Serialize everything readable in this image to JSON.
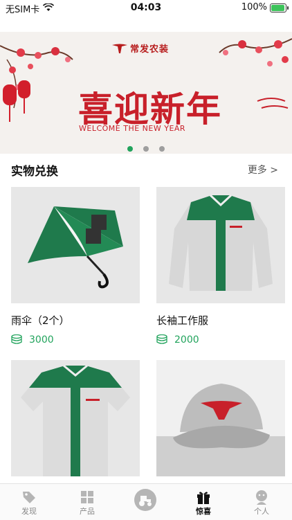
{
  "status_bar": {
    "carrier": "无SIM卡",
    "time": "04:03",
    "battery": "100%"
  },
  "banner": {
    "brand": "常发农装",
    "headline": "喜迎新年",
    "subtitle": "WELCOME THE NEW YEAR",
    "slide_count": 3,
    "active_slide": 1
  },
  "section": {
    "title": "实物兑换",
    "more": "更多 >"
  },
  "products": [
    {
      "name": "雨伞（2个）",
      "points": "3000",
      "icon": "coins-icon"
    },
    {
      "name": "长袖工作服",
      "points": "2000",
      "icon": "coins-icon"
    },
    {
      "name": "",
      "points": "",
      "icon": "coins-icon"
    },
    {
      "name": "",
      "points": "",
      "icon": "coins-icon"
    }
  ],
  "tabbar": {
    "items": [
      {
        "label": "发现",
        "icon": "tag-icon"
      },
      {
        "label": "产品",
        "icon": "grid-icon"
      },
      {
        "label": "",
        "icon": "tractor-icon"
      },
      {
        "label": "惊喜",
        "icon": "gift-icon"
      },
      {
        "label": "个人",
        "icon": "person-icon"
      }
    ],
    "active": 3
  },
  "colors": {
    "accent": "#21a35c",
    "banner_red": "#c8202a",
    "uniform_green": "#1f7a4c"
  }
}
